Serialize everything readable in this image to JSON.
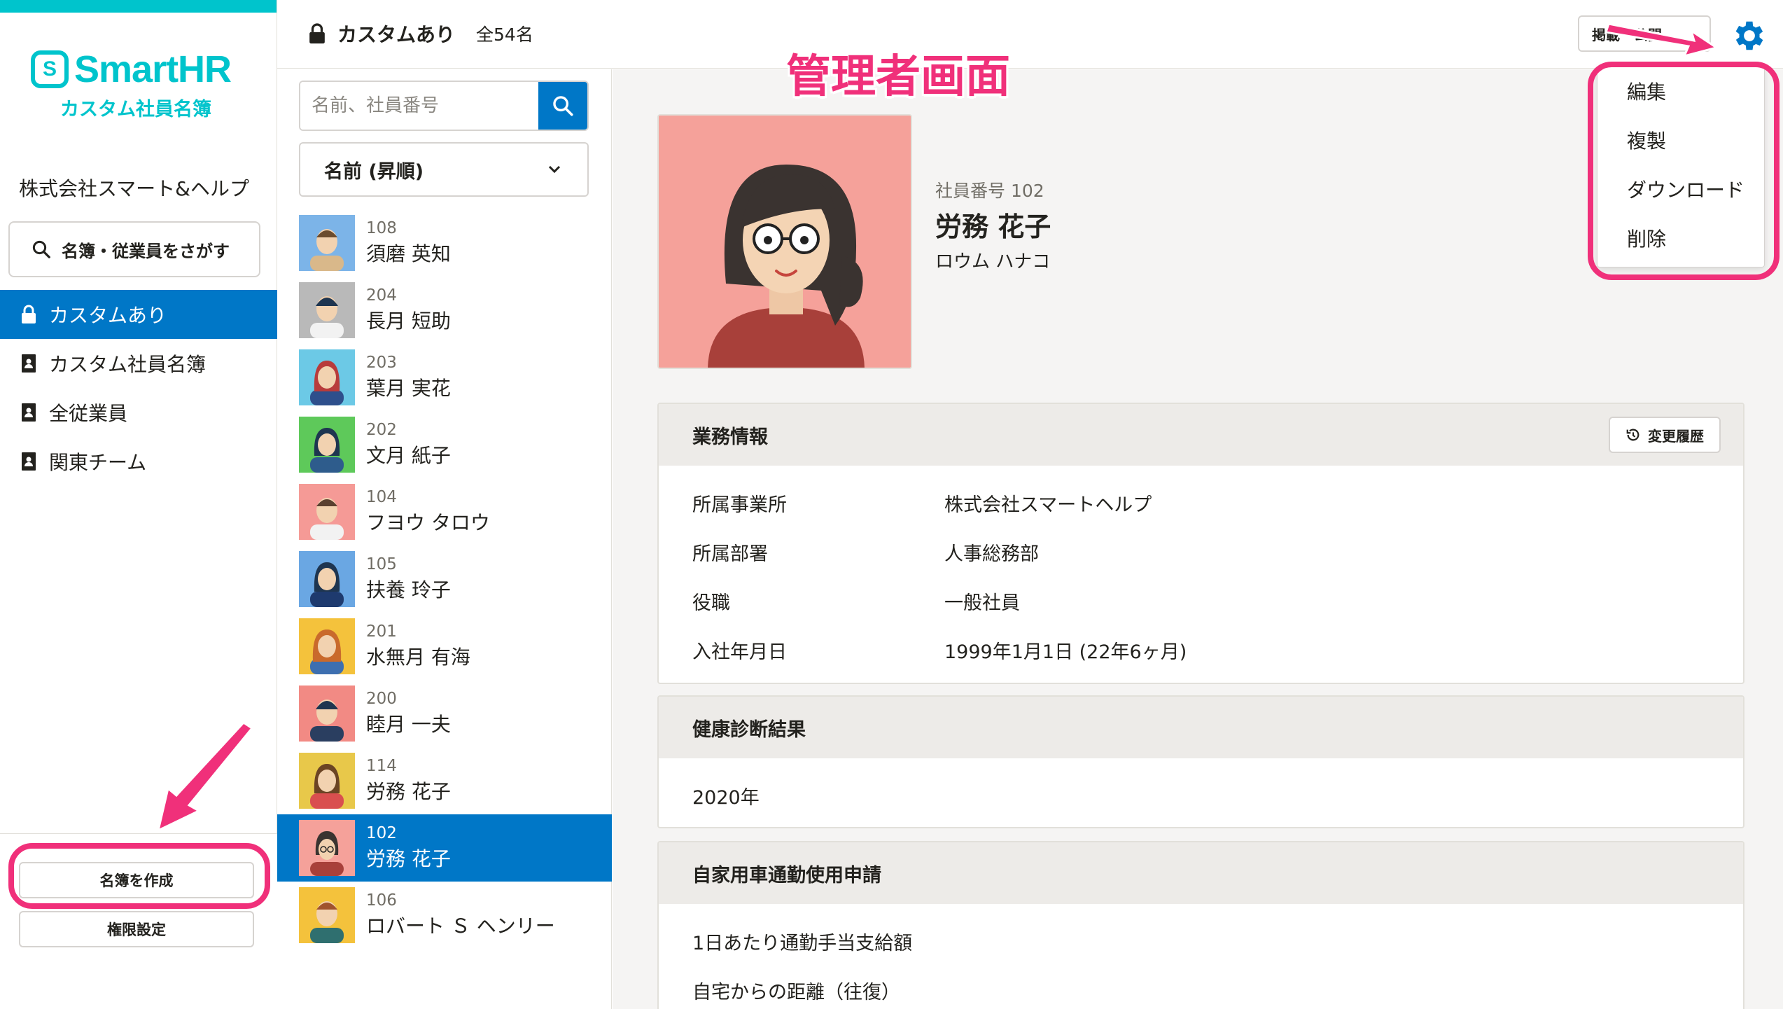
{
  "app": {
    "logo_text": "SmartHR",
    "logo_subtitle": "カスタム社員名簿",
    "company_name": "株式会社スマート&ヘルプ",
    "search_button": "名簿・従業員をさがす",
    "brand_color": "#00c4cc",
    "accent_color": "#0077c7",
    "annotation_color": "#f0307a"
  },
  "sidebar": {
    "items": [
      {
        "label": "カスタムあり",
        "icon": "lock-icon",
        "active": true
      },
      {
        "label": "カスタム社員名簿",
        "icon": "address-book-icon",
        "active": false
      },
      {
        "label": "全従業員",
        "icon": "address-book-icon",
        "active": false
      },
      {
        "label": "関東チーム",
        "icon": "address-book-icon",
        "active": false
      }
    ],
    "create_button": "名簿を作成",
    "permission_button": "権限設定"
  },
  "header": {
    "title": "カスタムあり",
    "count": "全54名",
    "publish_button": "掲載・公開",
    "gear_icon": "gear-icon"
  },
  "list": {
    "search_placeholder": "名前、社員番号",
    "sort_label": "名前 (昇順)",
    "employees": [
      {
        "no": "108",
        "name": "須磨 英知"
      },
      {
        "no": "204",
        "name": "長月 短助"
      },
      {
        "no": "203",
        "name": "葉月 実花"
      },
      {
        "no": "202",
        "name": "文月 紙子"
      },
      {
        "no": "104",
        "name": "フヨウ タロウ"
      },
      {
        "no": "105",
        "name": "扶養 玲子"
      },
      {
        "no": "201",
        "name": "水無月 有海"
      },
      {
        "no": "200",
        "name": "睦月 一夫"
      },
      {
        "no": "114",
        "name": "労務 花子"
      },
      {
        "no": "102",
        "name": "労務 花子"
      },
      {
        "no": "106",
        "name": "ロバート Ｓ ヘンリー"
      }
    ]
  },
  "profile": {
    "employee_no": "社員番号 102",
    "name": "労務 花子",
    "kana": "ロウム ハナコ"
  },
  "sections": {
    "work": {
      "title": "業務情報",
      "history_button": "変更履歴",
      "rows": [
        {
          "label": "所属事業所",
          "value": "株式会社スマートヘルプ"
        },
        {
          "label": "所属部署",
          "value": "人事総務部"
        },
        {
          "label": "役職",
          "value": "一般社員"
        },
        {
          "label": "入社年月日",
          "value": "1999年1月1日 (22年6ヶ月)"
        }
      ]
    },
    "health": {
      "title": "健康診断結果",
      "value": "2020年"
    },
    "car": {
      "title": "自家用車通勤使用申請",
      "rows": [
        "1日あたり通勤手当支給額",
        "自宅からの距離（往復）"
      ]
    }
  },
  "dropdown": {
    "items": [
      "編集",
      "複製",
      "ダウンロード",
      "削除"
    ]
  },
  "annotation": {
    "title": "管理者画面"
  }
}
